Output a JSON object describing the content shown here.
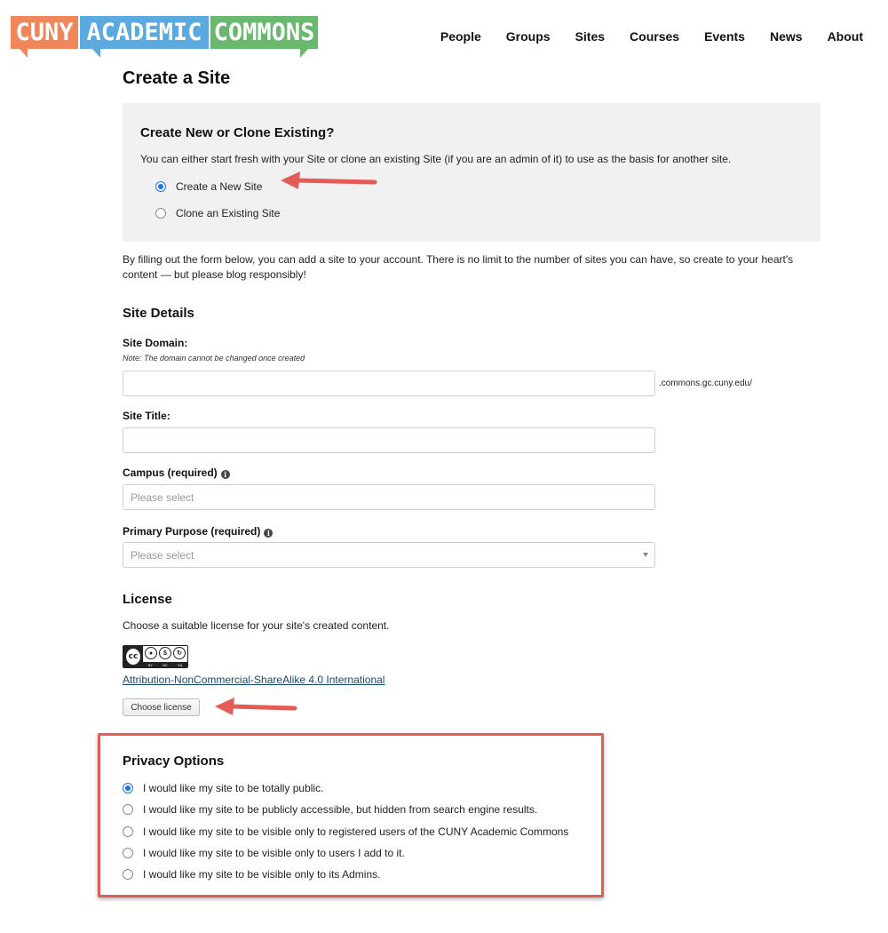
{
  "header": {
    "logo": {
      "part1": "CUNY",
      "part2": "ACADEMIC",
      "part3": "COMMONS"
    },
    "nav": [
      "People",
      "Groups",
      "Sites",
      "Courses",
      "Events",
      "News",
      "About"
    ]
  },
  "page_title": "Create a Site",
  "clone_section": {
    "title": "Create New or Clone Existing?",
    "description": "You can either start fresh with your Site or clone an existing Site (if you are an admin of it) to use as the basis for another site.",
    "options": [
      {
        "label": "Create a New Site",
        "checked": true
      },
      {
        "label": "Clone an Existing Site",
        "checked": false
      }
    ]
  },
  "intro_text": "By filling out the form below, you can add a site to your account. There is no limit to the number of sites you can have, so create to your heart's content — but please blog responsibly!",
  "site_details": {
    "title": "Site Details",
    "domain_label": "Site Domain:",
    "domain_note": "Note: The domain cannot be changed once created",
    "domain_value": "",
    "domain_suffix": ".commons.gc.cuny.edu/",
    "title_label": "Site Title:",
    "title_value": "",
    "campus_label": "Campus (required)",
    "campus_placeholder": "Please select",
    "purpose_label": "Primary Purpose (required)",
    "purpose_placeholder": "Please select"
  },
  "license": {
    "title": "License",
    "description": "Choose a suitable license for your site's created content.",
    "link_text": "Attribution-NonCommercial-ShareAlike 4.0 International",
    "button_label": "Choose license",
    "badge": {
      "cc": "cc",
      "by": "BY",
      "nc": "NC",
      "sa": "SA"
    }
  },
  "privacy": {
    "title": "Privacy Options",
    "options": [
      {
        "label": "I would like my site to be totally public.",
        "checked": true
      },
      {
        "label": "I would like my site to be publicly accessible, but hidden from search engine results.",
        "checked": false
      },
      {
        "label": "I would like my site to be visible only to registered users of the CUNY Academic Commons",
        "checked": false
      },
      {
        "label": "I would like my site to be visible only to users I add to it.",
        "checked": false
      },
      {
        "label": "I would like my site to be visible only to its Admins.",
        "checked": false
      }
    ]
  },
  "colors": {
    "logo_orange": "#f0875a",
    "logo_blue": "#5aaadf",
    "logo_green": "#6ab86e",
    "annotation_red": "#e35c55",
    "radio_blue": "#1a73e8"
  }
}
